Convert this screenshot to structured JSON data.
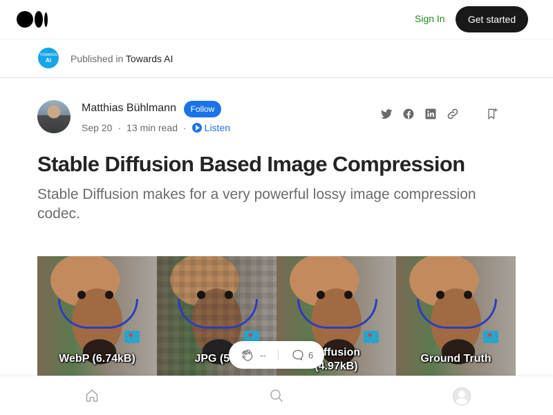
{
  "header": {
    "sign_in": "Sign In",
    "get_started": "Get started"
  },
  "publication": {
    "prefix": "Published in",
    "name": "Towards AI",
    "logo_line1": "TOWARDS",
    "logo_line2": "AI"
  },
  "author": {
    "name": "Matthias Bühlmann",
    "follow_label": "Follow",
    "date": "Sep 20",
    "read_time": "13 min read",
    "listen_label": "Listen"
  },
  "share_icons": [
    "twitter-icon",
    "facebook-icon",
    "linkedin-icon",
    "link-icon",
    "bookmark-icon"
  ],
  "article": {
    "title": "Stable Diffusion Based Image Compression",
    "subtitle": "Stable Diffusion makes for a very powerful lossy image compression codec."
  },
  "hero_labels": [
    "WebP (6.74kB)",
    "JPG (5.6",
    "Diffusion",
    "(4.97kB)",
    "Ground Truth"
  ],
  "actions": {
    "clap_count": "--",
    "comment_count": "6"
  },
  "colors": {
    "brand_green": "#1a8917",
    "follow_blue": "#1a73e8",
    "dark_button": "#191919"
  }
}
